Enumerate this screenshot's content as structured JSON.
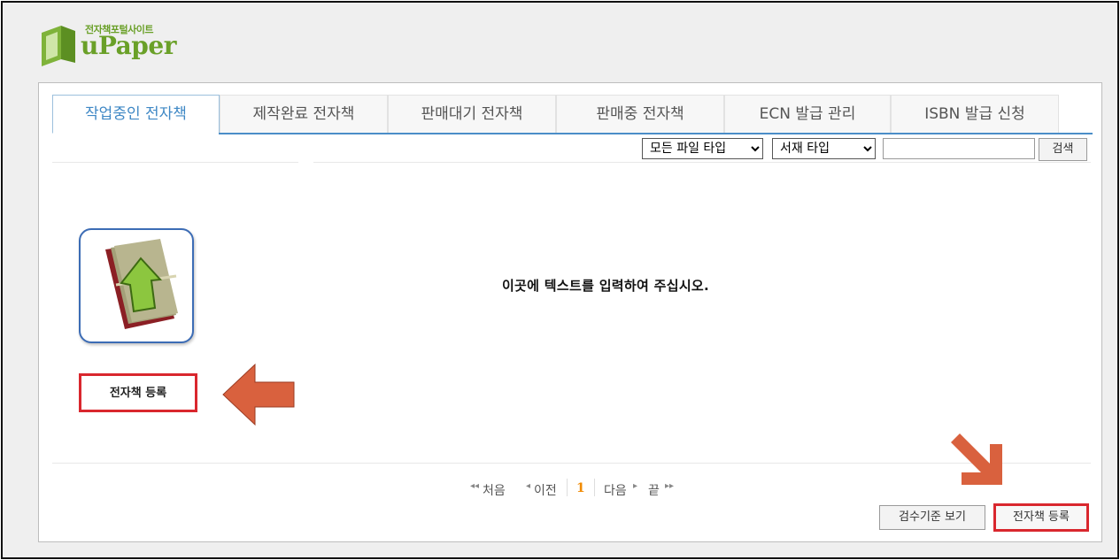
{
  "logo": {
    "sub": "전자책포털사이트",
    "main": "uPaper"
  },
  "tabs": [
    {
      "label": "작업중인 전자책"
    },
    {
      "label": "제작완료 전자책"
    },
    {
      "label": "판매대기 전자책"
    },
    {
      "label": "판매중 전자책"
    },
    {
      "label": "ECN 발급 관리"
    },
    {
      "label": "ISBN 발급 신청"
    }
  ],
  "toolbar": {
    "file_type": "모든 파일 타입",
    "book_type": "서재 타입",
    "search_value": "",
    "search_button": "검색"
  },
  "upload": {
    "register_label": "전자책 등록"
  },
  "main": {
    "placeholder_text": "이곳에 텍스트를 입력하여 주십시오."
  },
  "pagination": {
    "first": "처음",
    "prev": "이전",
    "current": "1",
    "next": "다음",
    "last": "끝"
  },
  "footer": {
    "criteria_button": "검수기준 보기",
    "register_button": "전자책 등록"
  },
  "colors": {
    "accent": "#4b8ec8",
    "highlight_box": "#d9272e",
    "arrow": "#d9613e",
    "logo_green": "#6aa028",
    "page_current": "#f08a00"
  }
}
